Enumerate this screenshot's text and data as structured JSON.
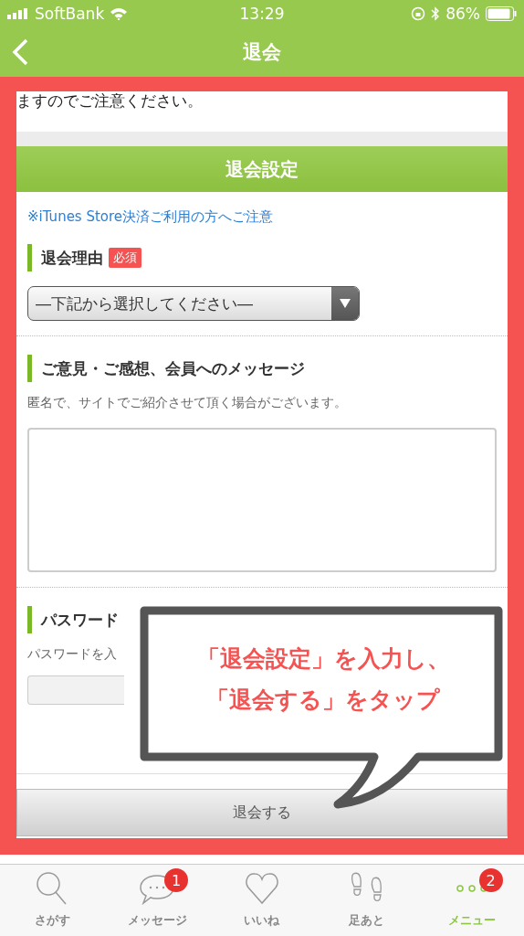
{
  "status_bar": {
    "carrier": "SoftBank",
    "time": "13:29",
    "battery": "86%"
  },
  "nav": {
    "title": "退会"
  },
  "intro_tail": "ますのでご注意ください。",
  "section_title": "退会設定",
  "itunes_link": "※iTunes Store決済ご利用の方へご注意",
  "reason": {
    "label": "退会理由",
    "badge": "必須",
    "placeholder": "―下記から選択してください―"
  },
  "message": {
    "label": "ご意見・ご感想、会員へのメッセージ",
    "hint": "匿名で、サイトでご紹介させて頂く場合がございます。"
  },
  "password": {
    "label": "パスワード",
    "hint": "パスワードを入"
  },
  "submit": "退会する",
  "callout": [
    "「退会設定」を入力し、",
    "「退会する」をタップ"
  ],
  "tabs": [
    {
      "kind": "search",
      "label": "さがす",
      "selected": false
    },
    {
      "kind": "message",
      "label": "メッセージ",
      "badge": "1",
      "selected": false
    },
    {
      "kind": "heart",
      "label": "いいね",
      "selected": false
    },
    {
      "kind": "footprint",
      "label": "足あと",
      "selected": false
    },
    {
      "kind": "menu",
      "label": "メニュー",
      "badge": "2",
      "selected": true
    }
  ]
}
